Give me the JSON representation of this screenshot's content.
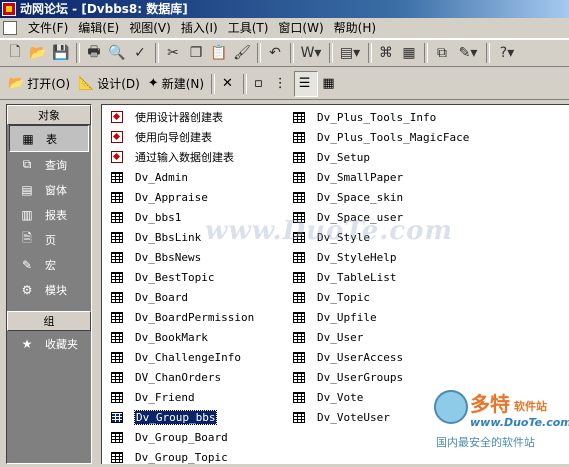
{
  "window": {
    "title": "动网论坛 - [Dvbbs8: 数据库]"
  },
  "menu": [
    "文件(F)",
    "编辑(E)",
    "视图(V)",
    "插入(I)",
    "工具(T)",
    "窗口(W)",
    "帮助(H)"
  ],
  "db_toolbar": {
    "open": "打开(O)",
    "design": "设计(D)",
    "new": "新建(N)"
  },
  "sidebar": {
    "objects_header": "对象",
    "items": [
      {
        "label": "表",
        "icon": "table-icon"
      },
      {
        "label": "查询",
        "icon": "query-icon"
      },
      {
        "label": "窗体",
        "icon": "form-icon"
      },
      {
        "label": "报表",
        "icon": "report-icon"
      },
      {
        "label": "页",
        "icon": "page-icon"
      },
      {
        "label": "宏",
        "icon": "macro-icon"
      },
      {
        "label": "模块",
        "icon": "module-icon"
      }
    ],
    "groups_header": "组",
    "group_items": [
      {
        "label": "收藏夹",
        "icon": "favorites-icon"
      }
    ]
  },
  "objects": {
    "col1": [
      {
        "label": "使用设计器创建表",
        "type": "wizard"
      },
      {
        "label": "使用向导创建表",
        "type": "wizard"
      },
      {
        "label": "通过输入数据创建表",
        "type": "wizard"
      },
      {
        "label": "Dv_Admin",
        "type": "table"
      },
      {
        "label": "Dv_Appraise",
        "type": "table"
      },
      {
        "label": "Dv_bbs1",
        "type": "table"
      },
      {
        "label": "Dv_BbsLink",
        "type": "table"
      },
      {
        "label": "Dv_BbsNews",
        "type": "table"
      },
      {
        "label": "Dv_BestTopic",
        "type": "table"
      },
      {
        "label": "Dv_Board",
        "type": "table"
      },
      {
        "label": "Dv_BoardPermission",
        "type": "table"
      },
      {
        "label": "Dv_BookMark",
        "type": "table"
      },
      {
        "label": "Dv_ChallengeInfo",
        "type": "table"
      },
      {
        "label": "DV_ChanOrders",
        "type": "table"
      },
      {
        "label": "Dv_Friend",
        "type": "table"
      },
      {
        "label": "Dv_Group_bbs",
        "type": "table",
        "selected": true
      },
      {
        "label": "Dv_Group_Board",
        "type": "table"
      },
      {
        "label": "Dv_Group_Topic",
        "type": "table"
      }
    ],
    "col2": [
      {
        "label": "Dv_Plus_Tools_Info",
        "type": "table"
      },
      {
        "label": "Dv_Plus_Tools_MagicFace",
        "type": "table"
      },
      {
        "label": "Dv_Setup",
        "type": "table"
      },
      {
        "label": "Dv_SmallPaper",
        "type": "table"
      },
      {
        "label": "Dv_Space_skin",
        "type": "table"
      },
      {
        "label": "Dv_Space_user",
        "type": "table"
      },
      {
        "label": "Dv_Style",
        "type": "table"
      },
      {
        "label": "Dv_StyleHelp",
        "type": "table"
      },
      {
        "label": "Dv_TableList",
        "type": "table"
      },
      {
        "label": "Dv_Topic",
        "type": "table"
      },
      {
        "label": "Dv_Upfile",
        "type": "table"
      },
      {
        "label": "Dv_User",
        "type": "table"
      },
      {
        "label": "Dv_UserAccess",
        "type": "table"
      },
      {
        "label": "Dv_UserGroups",
        "type": "table"
      },
      {
        "label": "Dv_Vote",
        "type": "table"
      },
      {
        "label": "Dv_VoteUser",
        "type": "table"
      }
    ]
  },
  "watermark": "www.DuoTe.com",
  "brand": {
    "name": "多特",
    "sub": "软件站",
    "url": "www.DuoTe.com",
    "tagline": "国内最安全的软件站"
  }
}
